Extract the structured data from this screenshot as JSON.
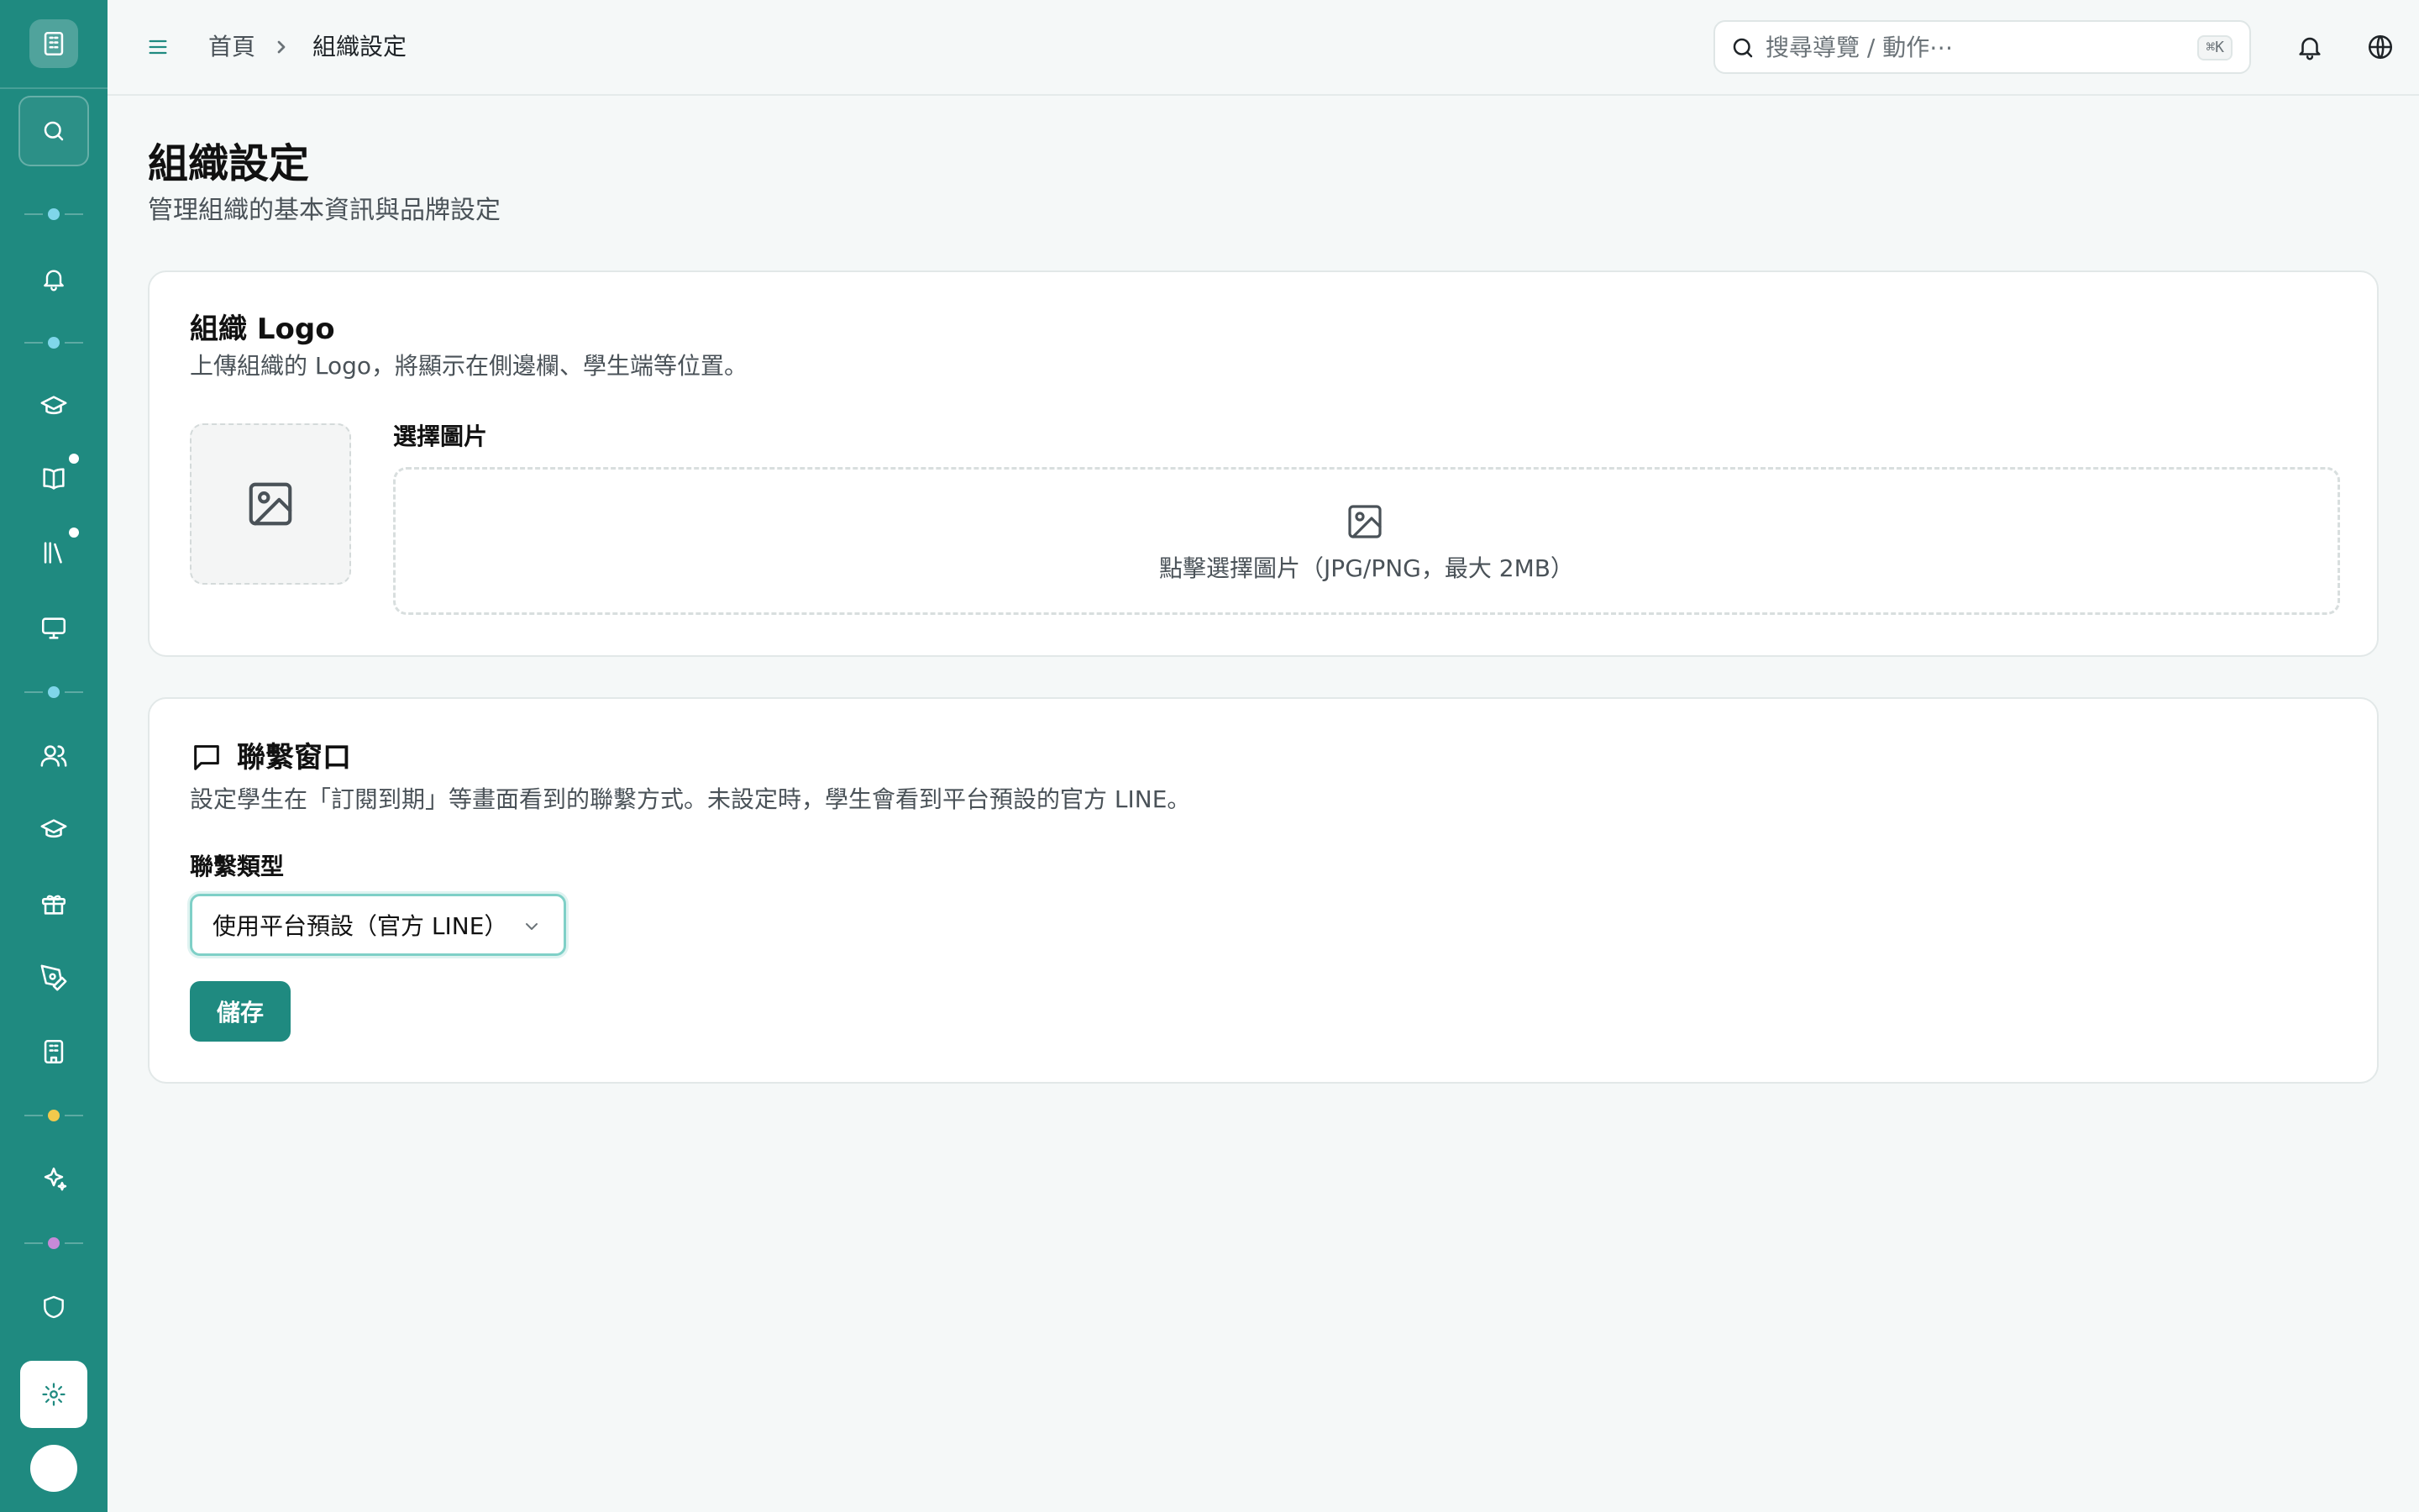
{
  "colors": {
    "brand": "#1f8a80",
    "sidebar_dot_teal": "#7fd6ea",
    "sidebar_dot_yellow": "#f2c94c",
    "sidebar_dot_purple": "#c78ad8"
  },
  "sidebar": {
    "icons": [
      "building-icon",
      "search-icon",
      "bell-icon",
      "graduation-cap-icon",
      "book-open-icon",
      "library-icon",
      "monitor-icon",
      "users-icon",
      "graduation-cap-icon",
      "gift-icon",
      "pen-tool-icon",
      "building-icon",
      "sparkles-icon",
      "shield-icon",
      "gear-icon"
    ]
  },
  "header": {
    "breadcrumb": {
      "home": "首頁",
      "current": "組織設定"
    },
    "search": {
      "placeholder": "搜尋導覽 / 動作⋯",
      "shortcut": "⌘K"
    }
  },
  "page": {
    "title": "組織設定",
    "subtitle": "管理組織的基本資訊與品牌設定"
  },
  "logo_card": {
    "title": "組織 Logo",
    "description": "上傳組織的 Logo，將顯示在側邊欄、學生端等位置。",
    "upload_label": "選擇圖片",
    "dropzone_hint": "點擊選擇圖片（JPG/PNG，最大 2MB）"
  },
  "contact_card": {
    "title": "聯繫窗口",
    "description": "設定學生在「訂閱到期」等畫面看到的聯繫方式。未設定時，學生會看到平台預設的官方 LINE。",
    "field_label": "聯繫類型",
    "selected": "使用平台預設（官方 LINE）",
    "save_label": "儲存"
  }
}
